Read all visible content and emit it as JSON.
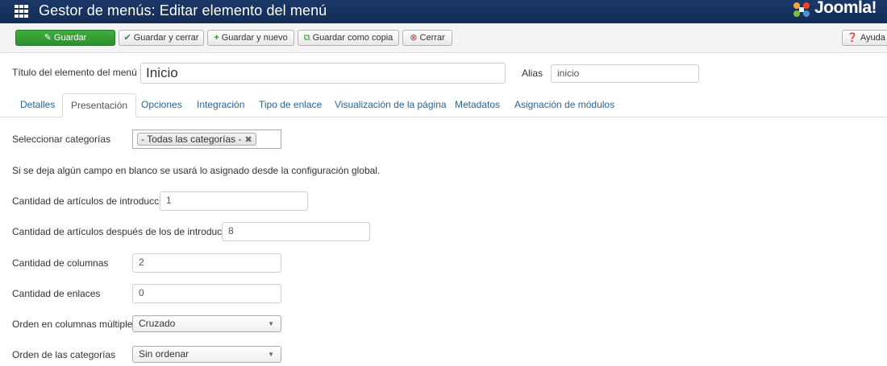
{
  "header": {
    "title": "Gestor de menús: Editar elemento del menú",
    "brand": "Joomla!",
    "menu_icon": "grid-icon"
  },
  "toolbar": {
    "save": "Guardar",
    "save_close": "Guardar y cerrar",
    "save_new": "Guardar y nuevo",
    "save_copy": "Guardar como copia",
    "close": "Cerrar",
    "help": "Ayuda"
  },
  "title_row": {
    "title_label": "Título del elemento del menú *",
    "title_value": "Inicio",
    "alias_label": "Alias",
    "alias_value": "inicio"
  },
  "tabs": [
    {
      "label": "Detalles",
      "active": false
    },
    {
      "label": "Presentación",
      "active": true
    },
    {
      "label": "Opciones",
      "active": false
    },
    {
      "label": "Integración",
      "active": false
    },
    {
      "label": "Tipo de enlace",
      "active": false
    },
    {
      "label": "Visualización de la página",
      "active": false
    },
    {
      "label": "Metadatos",
      "active": false
    },
    {
      "label": "Asignación de módulos",
      "active": false
    }
  ],
  "form": {
    "categories_label": "Seleccionar categorías",
    "categories_chip": "- Todas las categorías -",
    "note": "Si se deja algún campo en blanco se usará lo asignado desde la configuración global.",
    "intro_label": "Cantidad de artículos de introducción",
    "intro_value": "1",
    "after_intro_label": "Cantidad de artículos después de los de introducción",
    "after_intro_value": "8",
    "columns_label": "Cantidad de columnas",
    "columns_value": "2",
    "links_label": "Cantidad de enlaces",
    "links_value": "0",
    "multi_column_order_label": "Orden en columnas múltiples",
    "multi_column_order_value": "Cruzado",
    "category_order_label": "Orden de las categorías",
    "category_order_value": "Sin ordenar"
  },
  "colors": {
    "header_bg": "#1a3867",
    "save_green": "#2e8f2e",
    "link_blue": "#2a6496"
  }
}
